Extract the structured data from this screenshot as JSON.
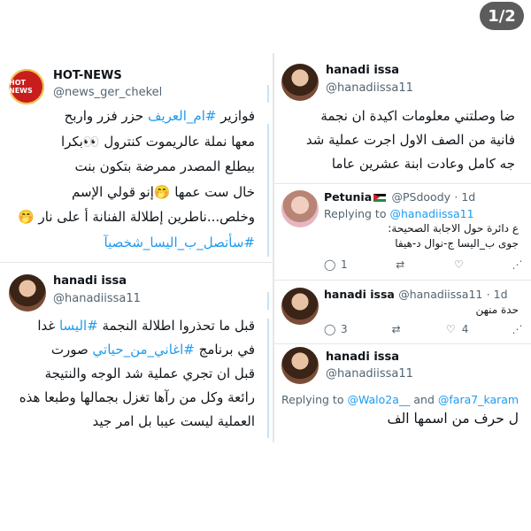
{
  "page_indicator": "1/2",
  "left_top": {
    "logo_text": "HOT NEWS",
    "name": "HOT-NEWS",
    "handle": "@news_ger_chekel",
    "lines": [
      {
        "pre": "فوازير ",
        "tag": "#ام_العريف",
        "post": " حزر فزر واربح"
      },
      {
        "pre": "معها نملة عالريموت كنترول 👀بكرا",
        "tag": "",
        "post": ""
      },
      {
        "pre": "بيطلع المصدر ممرضة بتكون بنت",
        "tag": "",
        "post": ""
      },
      {
        "pre": "خال ست عمها 🤭إنو قولي الإسم",
        "tag": "",
        "post": ""
      },
      {
        "pre": "وخلص...ناطرين إطلالة الفنانة أ على نار 🤭",
        "tag": "",
        "post": ""
      },
      {
        "pre": "",
        "tag": "#سأتصل_ب_اليسا_شخصيآ",
        "post": ""
      }
    ]
  },
  "left_bottom": {
    "name": "hanadi issa",
    "handle": "@hanadiissa11",
    "lines": [
      {
        "pre": "قبل ما تحذروا اطلالة النجمة ",
        "tag": "#اليسا",
        "post": "  غدا"
      },
      {
        "pre": "في برنامج ",
        "tag": "#اغاني_من_حياتي",
        "post": "  صورت"
      },
      {
        "pre": "قبل ان تجري عملية شد الوجه والنتيجة",
        "tag": "",
        "post": ""
      },
      {
        "pre": "رائعة وكل من رآها تغزل بجمالها وطبعا هذه",
        "tag": "",
        "post": ""
      },
      {
        "pre": "العملية ليست عيبا بل امر جيد",
        "tag": "",
        "post": ""
      }
    ]
  },
  "right": {
    "tweet1": {
      "name": "hanadi issa",
      "handle": "@hanadiissa11",
      "lines": [
        "ضا وصلتني معلومات اكيدة ان نجمة",
        "فانية من الصف الاول اجرت عملية شد",
        "جه كامل وعادت ابنة عشرين عاما"
      ]
    },
    "reply1": {
      "name": "Petunia",
      "handle": "@PSdoody",
      "time": "· 1d",
      "replying_prefix": "Replying to ",
      "replying_to": "@hanadiissa11",
      "lines": [
        "ع دائرة حول الاجابة الصحيحة:",
        "جوى  ب_اليسا   ج-نوال   د-هيفا"
      ],
      "reply_count": "1",
      "retweet_count": "",
      "like_count": ""
    },
    "reply2": {
      "name": "hanadi issa",
      "handle": "@hanadiissa11",
      "time": "· 1d",
      "lines": [
        "حدة منهن"
      ],
      "reply_count": "3",
      "retweet_count": "",
      "like_count": "4"
    },
    "reply3": {
      "name": "hanadi issa",
      "handle": "@hanadiissa11",
      "replying_prefix": "Replying to ",
      "replying_to_1": "@Walo2a__",
      "and": " and ",
      "replying_to_2": "@fara7_karam",
      "lines": [
        "ل حرف من اسمها الف"
      ]
    }
  },
  "icons": {
    "reply": "reply-icon",
    "retweet": "retweet-icon",
    "like": "heart-icon",
    "share": "share-icon"
  },
  "colors": {
    "hashtag": "#1d9bf0",
    "secondary_text": "#536471",
    "badge_bg": "#5c5c5c",
    "logo_red": "#c81d1d"
  }
}
